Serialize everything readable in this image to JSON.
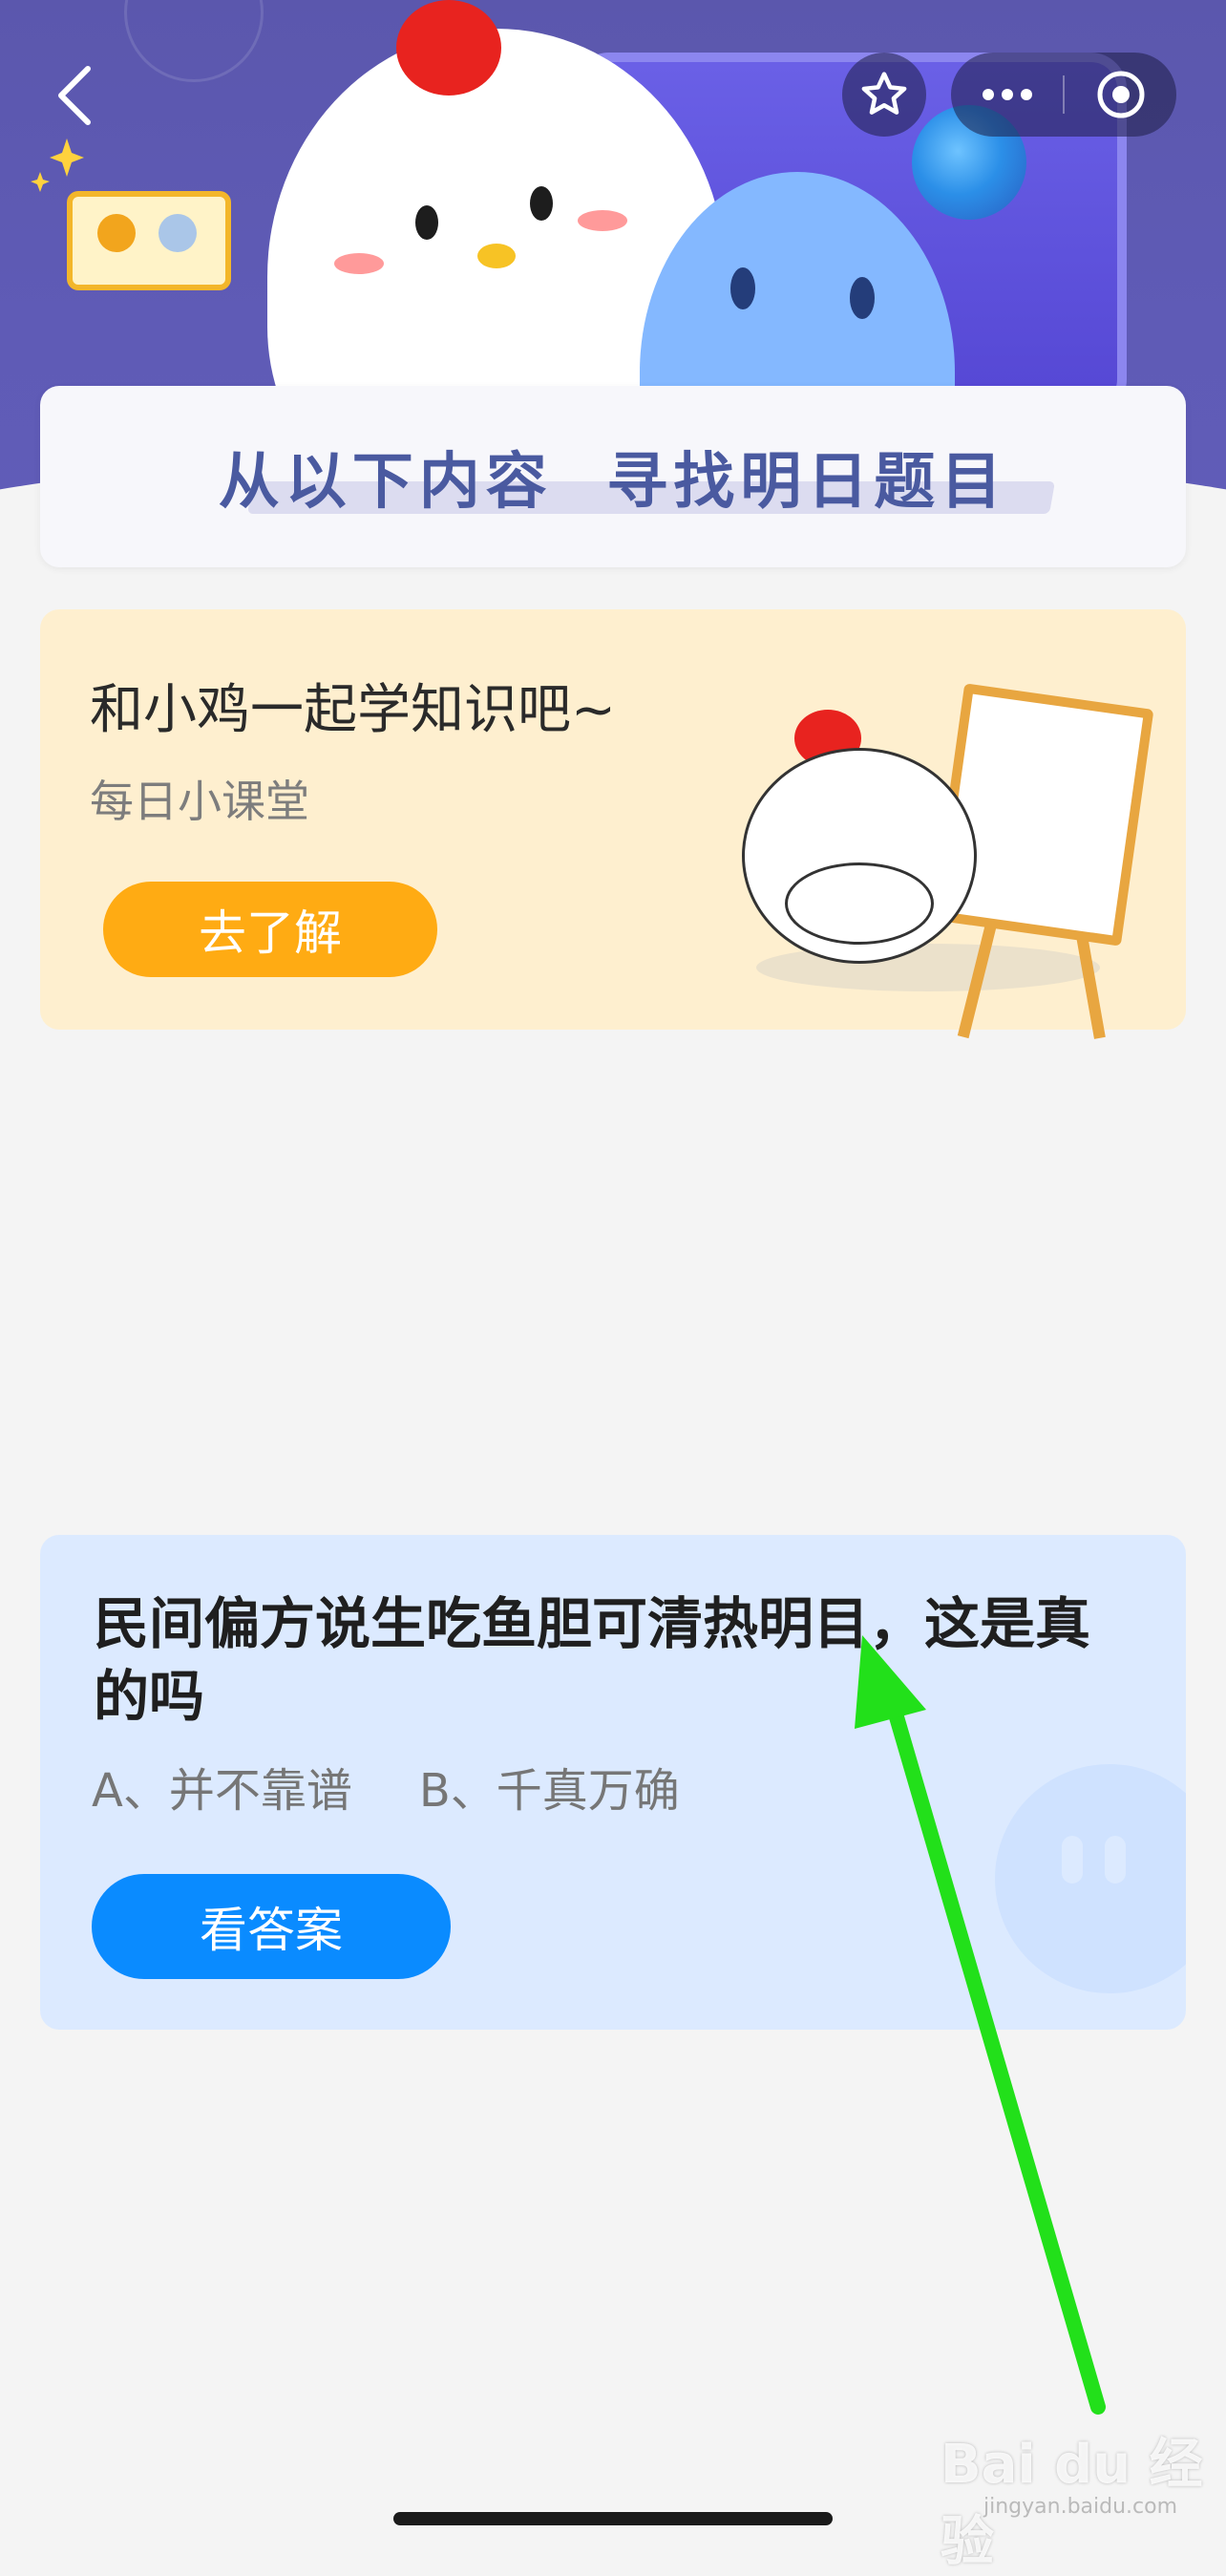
{
  "nav": {
    "back_icon": "chevron-left-icon",
    "favorite_icon": "star-icon",
    "more_icon": "ellipsis-icon",
    "close_icon": "target-circle-icon"
  },
  "banner": {
    "title": "从以下内容  寻找明日题目"
  },
  "learn_card": {
    "title": "和小鸡一起学知识吧~",
    "subtitle": "每日小课堂",
    "button_label": "去了解"
  },
  "question_card": {
    "question": "民间偏方说生吃鱼胆可清热明目，这是真的吗",
    "option_a": "A、并不靠谱",
    "option_b": "B、千真万确",
    "button_label": "看答案"
  },
  "watermark": {
    "brand": "Bai du 经验",
    "url": "jingyan.baidu.com"
  },
  "colors": {
    "header_bg": "#5b57ad",
    "banner_text": "#4a5aa0",
    "learn_card_bg": "#feefcf",
    "learn_button": "#ffab13",
    "question_card_bg": "#dceaff",
    "answer_button": "#0a8bff",
    "annotation_arrow": "#22e01a"
  }
}
